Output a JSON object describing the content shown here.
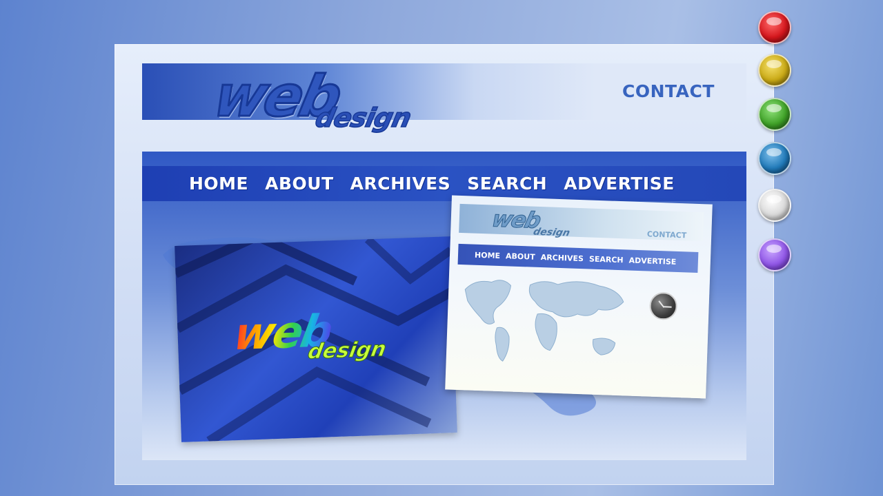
{
  "site": {
    "logo_main": "web",
    "logo_sub": "design",
    "contact_label": "CONTACT",
    "nav": [
      {
        "label": "HOME"
      },
      {
        "label": "ABOUT"
      },
      {
        "label": "ARCHIVES"
      },
      {
        "label": "SEARCH"
      },
      {
        "label": "ADVERTISE"
      }
    ]
  },
  "preview_left": {
    "logo_main": "web",
    "logo_sub": "design"
  },
  "preview_right": {
    "logo_main": "web",
    "logo_sub": "design",
    "contact_label": "CONTACT",
    "nav": [
      {
        "label": "HOME"
      },
      {
        "label": "ABOUT"
      },
      {
        "label": "ARCHIVES"
      },
      {
        "label": "SEARCH"
      },
      {
        "label": "ADVERTISE"
      }
    ],
    "map_icon": "world-map-icon",
    "clock_icon": "clock-icon"
  },
  "color_dots": [
    {
      "name": "red",
      "color": "#d4161c"
    },
    {
      "name": "yellow",
      "color": "#c9a915"
    },
    {
      "name": "green",
      "color": "#3fa127"
    },
    {
      "name": "blue",
      "color": "#2079b8"
    },
    {
      "name": "white",
      "color": "#d8d8d8"
    },
    {
      "name": "purple",
      "color": "#8f55e6"
    }
  ],
  "colors": {
    "accent": "#2f56bd",
    "nav_bg": "#2448b8",
    "contact": "#3864bf"
  }
}
